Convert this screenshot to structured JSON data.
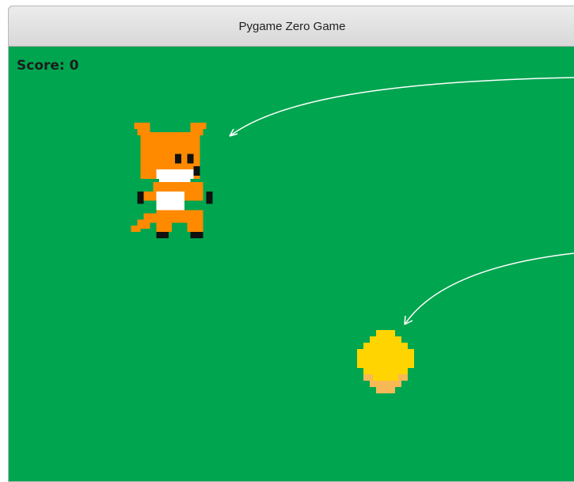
{
  "window": {
    "title": "Pygame Zero Game"
  },
  "hud": {
    "score_text": "Score: 0"
  },
  "sprites": [
    {
      "name": "fox",
      "icon": "fox-sprite-icon"
    },
    {
      "name": "coin",
      "icon": "coin-sprite-icon"
    }
  ],
  "colors": {
    "background": "#00a54f",
    "fox_orange": "#ff8a00",
    "coin_yellow": "#ffd400",
    "coin_shade": "#f7b955"
  }
}
